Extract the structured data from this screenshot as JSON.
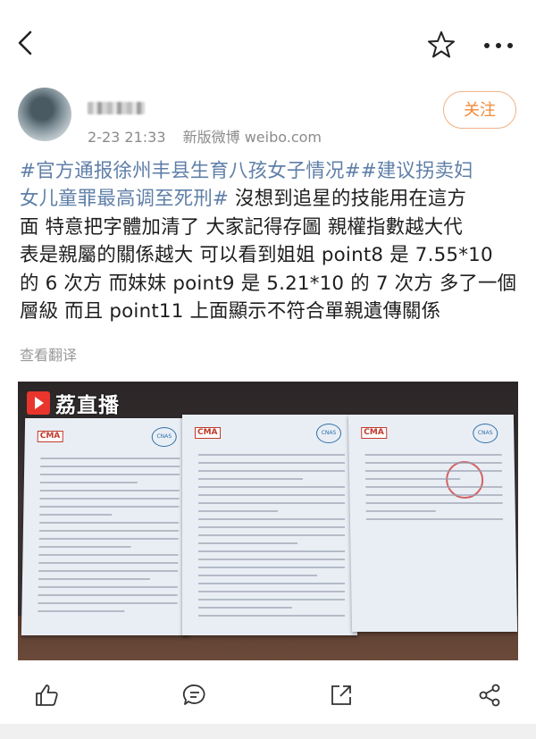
{
  "topbar": {
    "back": "back",
    "favorite": "favorite",
    "more": "more"
  },
  "post": {
    "username": "",
    "date": "2-23 21:33",
    "source": "新版微博 weibo.com",
    "follow_label": "关注",
    "content_lines": [
      [
        {
          "t": "#官方通报徐州丰县生育八孩女子情况##建议拐卖妇",
          "h": true
        }
      ],
      [
        {
          "t": "女儿童罪最高调至死刑#",
          "h": true
        },
        {
          "t": " 沒想到追星的技能用在這方",
          "h": false
        }
      ],
      [
        {
          "t": "面 特意把字體加清了 大家記得存圖 親權指數越大代",
          "h": false
        }
      ],
      [
        {
          "t": "表是親屬的關係越大 可以看到姐姐 point8 是 7.55*10",
          "h": false
        }
      ],
      [
        {
          "t": "的 6 次方 而妹妹 point9 是 5.21*10 的 7 次方 多了一個",
          "h": false
        }
      ],
      [
        {
          "t": "層級 而且 point11 上面顯示不符合單親遺傳關係",
          "h": false
        }
      ]
    ],
    "translate_label": "查看翻译",
    "image_watermark": "荔直播",
    "doc_logo_left": "CMA",
    "doc_logo_right": "CNAS"
  },
  "actions": [
    "like-icon",
    "comment-icon",
    "share-icon",
    "forward-icon"
  ],
  "colors": {
    "hashtag": "#5f7fa8",
    "follow": "#f08a38",
    "meta": "#8b8b8b"
  }
}
